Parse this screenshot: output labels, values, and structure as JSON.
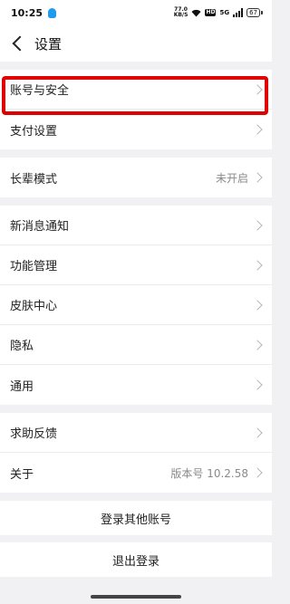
{
  "status_bar": {
    "time": "10:25",
    "net_speed_value": "77.0",
    "net_speed_unit": "KB/S",
    "hd_label": "HD",
    "network_label": "5G",
    "battery": "67"
  },
  "header": {
    "title": "设置"
  },
  "sections": {
    "account": {
      "security": "账号与安全",
      "payment": "支付设置"
    },
    "elder": {
      "label": "长辈模式",
      "value": "未开启"
    },
    "general": {
      "notifications": "新消息通知",
      "features": "功能管理",
      "skins": "皮肤中心",
      "privacy": "隐私",
      "common": "通用"
    },
    "help": {
      "feedback": "求助反馈",
      "about": "关于",
      "version": "版本号 10.2.58"
    }
  },
  "actions": {
    "login_other": "登录其他账号",
    "logout": "退出登录"
  },
  "colors": {
    "highlight": "#e00000",
    "background": "#f1f1f3"
  }
}
